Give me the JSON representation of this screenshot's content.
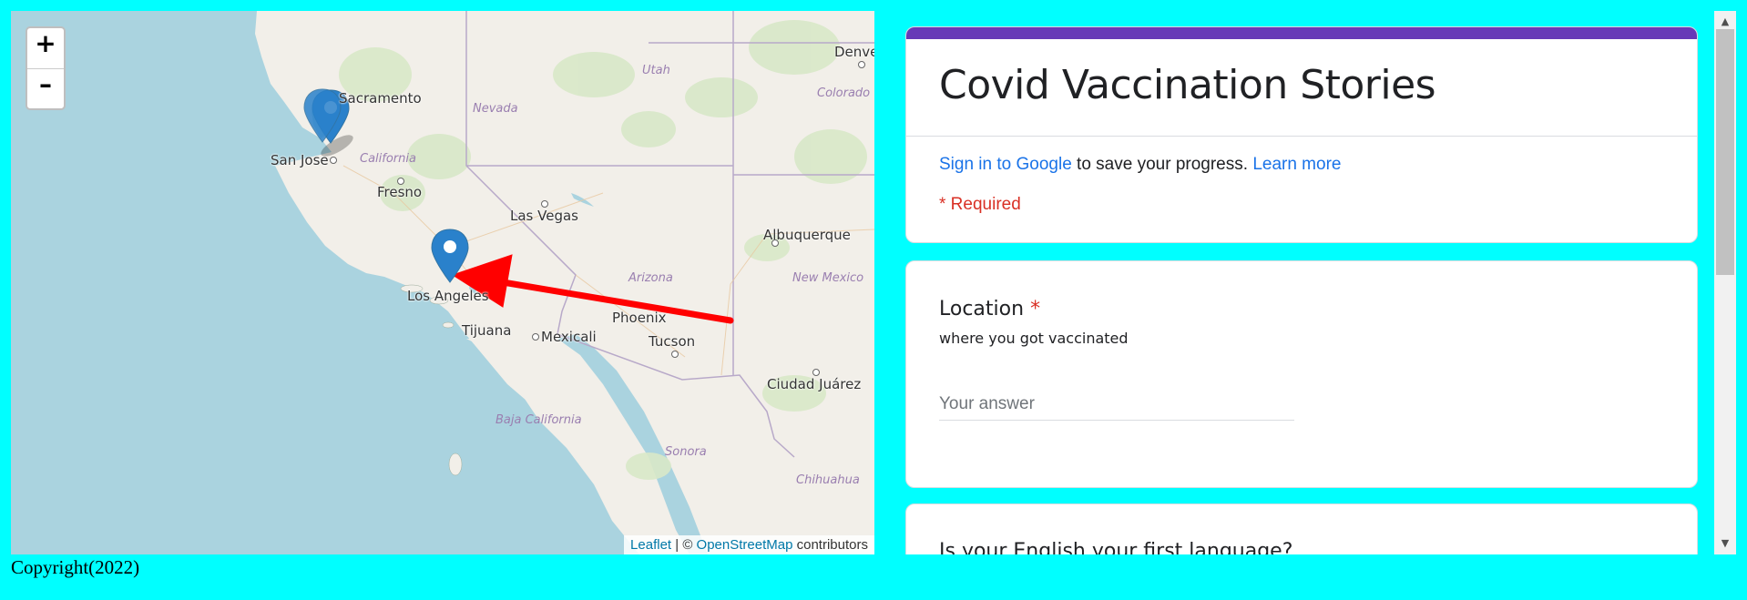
{
  "map": {
    "zoom_in": "+",
    "zoom_out": "–",
    "attribution": {
      "leaflet": "Leaflet",
      "separator": " | © ",
      "osm": "OpenStreetMap",
      "suffix": " contributors"
    },
    "cities": {
      "sacramento": "Sacramento",
      "san_jose": "San Jose",
      "fresno": "Fresno",
      "las_vegas": "Las Vegas",
      "los_angeles": "Los Angeles",
      "tijuana": "Tijuana",
      "mexicali": "Mexicali",
      "phoenix": "Phoenix",
      "tucson": "Tucson",
      "albuquerque": "Albuquerque",
      "ciudad_juarez": "Ciudad Juárez",
      "denver": "Denver"
    },
    "regions": {
      "utah": "Utah",
      "nevada": "Nevada",
      "colorado": "Colorado",
      "california": "California",
      "arizona": "Arizona",
      "new_mexico": "New Mexico",
      "baja_california": "Baja California",
      "sonora": "Sonora",
      "chihuahua": "Chihuahua"
    },
    "markers": [
      "bay-area-marker",
      "los-angeles-marker"
    ],
    "arrow_color": "#ff0000",
    "marker_color": "#2a81cb"
  },
  "form": {
    "title": "Covid Vaccination Stories",
    "signin_link": "Sign in to Google",
    "signin_text": " to save your progress. ",
    "learn_more": "Learn more",
    "required_note": "* Required",
    "questions": [
      {
        "title": "Location",
        "required_mark": "*",
        "description": "where you got vaccinated",
        "placeholder": "Your answer"
      },
      {
        "title": "Is your English your first language?"
      }
    ],
    "accent_color": "#673ab7"
  },
  "scrollbar": {
    "up": "▲",
    "down": "▼"
  },
  "footer": {
    "text": "Copyright(2022)"
  }
}
